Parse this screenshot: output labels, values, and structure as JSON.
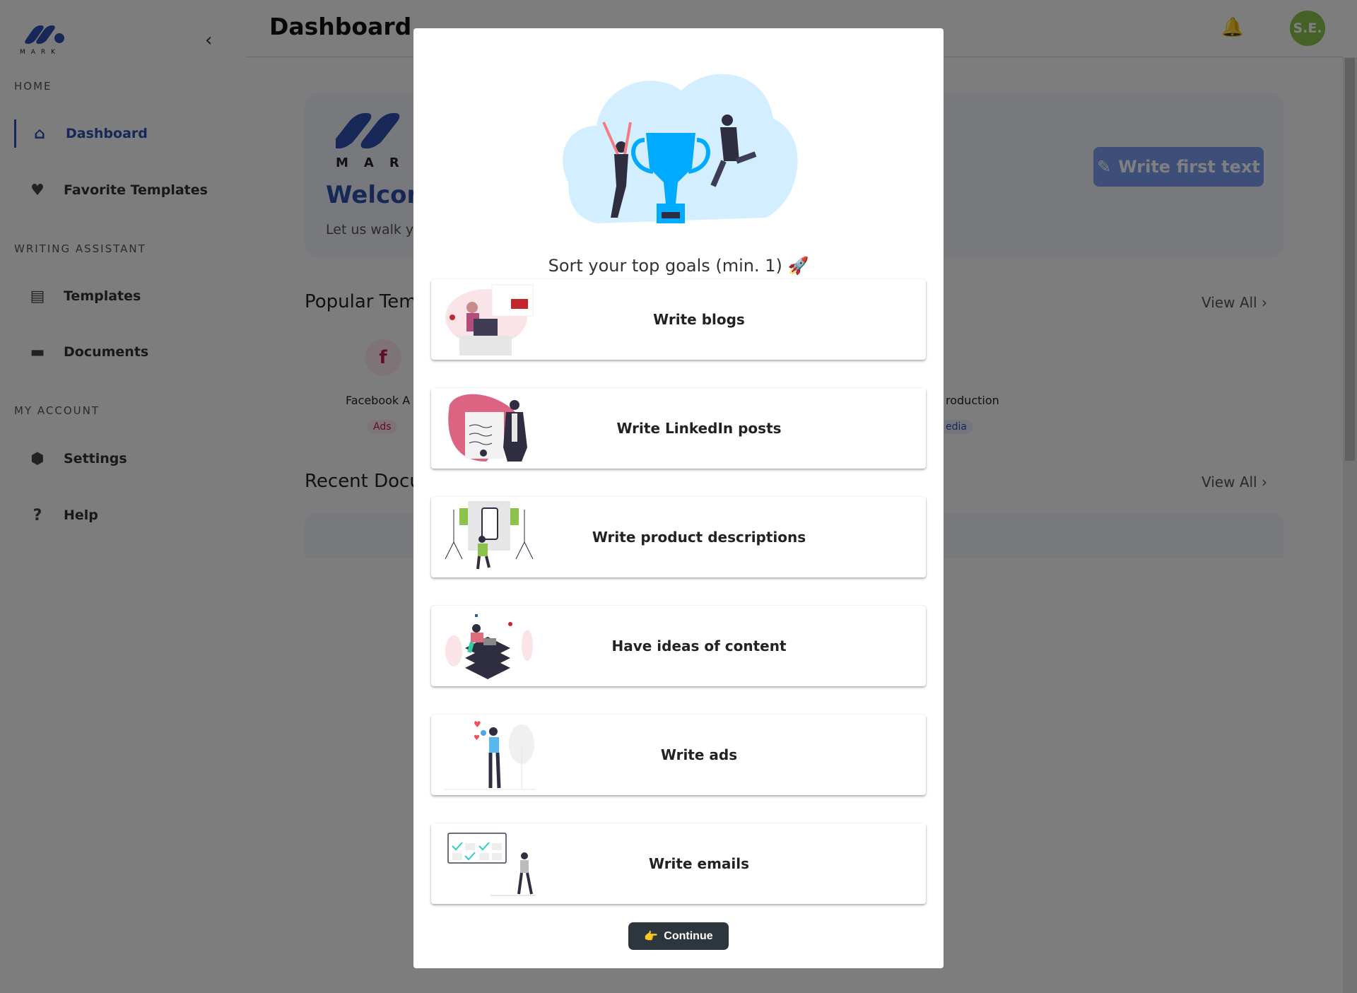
{
  "sidebar": {
    "logo_text": "MARK",
    "sections": [
      {
        "label": "HOME"
      },
      {
        "label": "WRITING ASSISTANT"
      },
      {
        "label": "MY ACCOUNT"
      }
    ],
    "items": [
      {
        "label": "Dashboard",
        "icon": "home-icon"
      },
      {
        "label": "Favorite Templates",
        "icon": "heart-icon"
      },
      {
        "label": "Templates",
        "icon": "file-icon"
      },
      {
        "label": "Documents",
        "icon": "folder-icon"
      },
      {
        "label": "Settings",
        "icon": "gear-icon"
      },
      {
        "label": "Help",
        "icon": "help-icon"
      }
    ]
  },
  "header": {
    "title": "Dashboard",
    "avatar": "S.E."
  },
  "main": {
    "welcome_title": "Welcom",
    "welcome_sub": "Let us walk y",
    "write_first": "Write first text",
    "popular": "Popular Tem",
    "recent": "Recent Docu",
    "view_all": "View All",
    "templates": [
      {
        "name": "Facebook A",
        "tag": "Ads",
        "icon": "f"
      },
      {
        "name": "roduction",
        "tag": "edia"
      }
    ]
  },
  "modal": {
    "title": "Sort your top goals (min. 1) 🚀",
    "goals": [
      "Write blogs",
      "Write LinkedIn posts",
      "Write product descriptions",
      "Have ideas of content",
      "Write ads",
      "Write emails"
    ],
    "continue": "Continue",
    "continue_emoji": "👉"
  },
  "colors": {
    "accent": "#2f4fb0",
    "avatar": "#8bc34a",
    "continue": "#2c363e",
    "trophy": "#00aaff"
  }
}
